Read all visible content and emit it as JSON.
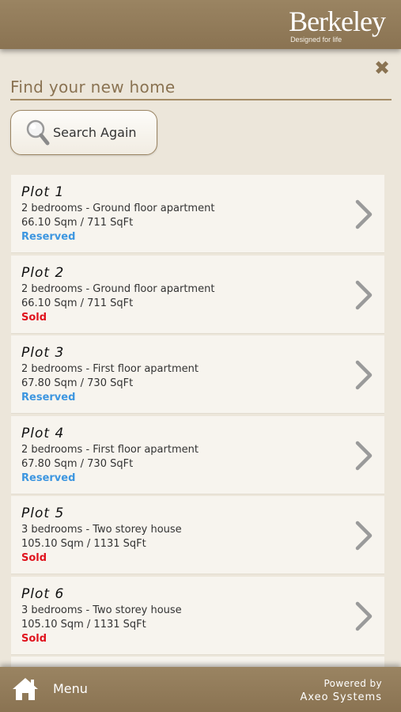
{
  "header": {
    "logo_text": "Berkeley",
    "logo_tagline": "Designed for life",
    "close_icon": "close-icon"
  },
  "main": {
    "title": "Find your new home",
    "search_again_label": "Search Again",
    "search_icon": "magnifier-icon"
  },
  "colors": {
    "brand": "#8a7352",
    "reserved": "#3d96e0",
    "sold": "#e0141e"
  },
  "plots": [
    {
      "title": "Plot 1",
      "description": "2 bedrooms - Ground floor apartment",
      "size": "66.10 Sqm / 711 SqFt",
      "status": "Reserved",
      "status_type": "reserved"
    },
    {
      "title": "Plot 2",
      "description": "2 bedrooms - Ground floor apartment",
      "size": "66.10 Sqm / 711 SqFt",
      "status": "Sold",
      "status_type": "sold"
    },
    {
      "title": "Plot 3",
      "description": "2 bedrooms - First floor apartment",
      "size": "67.80 Sqm / 730 SqFt",
      "status": "Reserved",
      "status_type": "reserved"
    },
    {
      "title": "Plot 4",
      "description": "2 bedrooms - First floor apartment",
      "size": "67.80 Sqm / 730 SqFt",
      "status": "Reserved",
      "status_type": "reserved"
    },
    {
      "title": "Plot 5",
      "description": "3 bedrooms - Two storey house",
      "size": "105.10 Sqm / 1131 SqFt",
      "status": "Sold",
      "status_type": "sold"
    },
    {
      "title": "Plot 6",
      "description": "3 bedrooms - Two storey house",
      "size": "105.10 Sqm / 1131 SqFt",
      "status": "Sold",
      "status_type": "sold"
    }
  ],
  "footer": {
    "menu_label": "Menu",
    "powered_by": "Powered by",
    "powered_brand": "Axeo Systems",
    "home_icon": "home-icon"
  }
}
